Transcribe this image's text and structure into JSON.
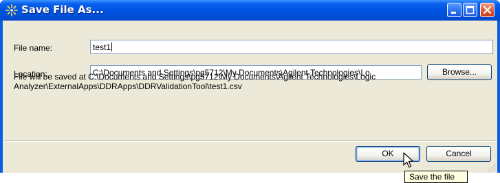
{
  "window": {
    "title": "Save File As...",
    "app_icon": "sparkle-icon",
    "controls": [
      "minimize-icon",
      "maximize-icon",
      "close-icon"
    ]
  },
  "form": {
    "file_name_label": "File name:",
    "file_name_value": "test1",
    "location_label": "Location:",
    "location_value": "C:\\Documents and Settings\\pg5712\\My Documents\\Agilent Technologies\\Lo",
    "browse_label": "Browse..."
  },
  "info": {
    "saved_at_text": "File will be saved at C:\\Documents and Settings\\pg5712\\My Documents\\Agilent Technologies\\Logic Analyzer\\ExternalApps\\DDRApps\\DDRValidationTool\\test1.csv"
  },
  "buttons": {
    "ok_label": "OK",
    "cancel_label": "Cancel"
  },
  "tooltip": {
    "text": "Save the file"
  },
  "colors": {
    "titlebar": "#0054e3",
    "dialog_face": "#ece9d8",
    "close_button": "#e0643f",
    "tooltip_bg": "#ffffe1"
  }
}
